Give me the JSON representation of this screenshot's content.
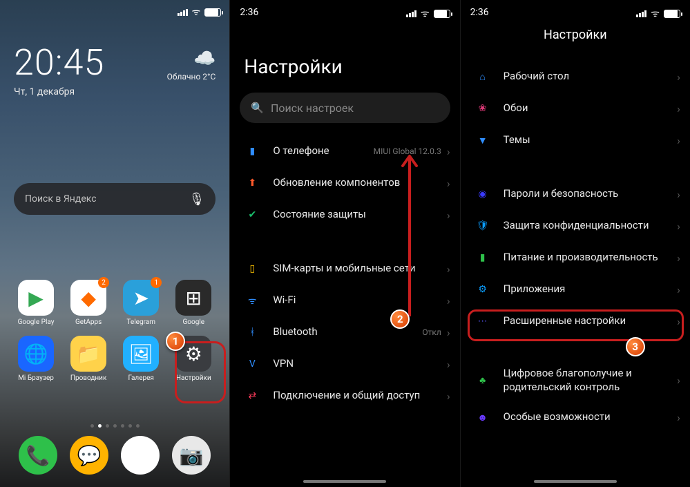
{
  "panel1": {
    "status": {
      "signal": "signal",
      "wifi": "wifi",
      "battery": "85%"
    },
    "clock": {
      "time": "20:45",
      "date": "Чт, 1 декабря"
    },
    "weather": {
      "icon": "☁️",
      "text": "Облачно 2°C"
    },
    "search": {
      "placeholder": "Поиск в Яндекс",
      "mic": "🎤"
    },
    "apps": [
      {
        "name": "google-play",
        "label": "Google Play",
        "bg": "#fff",
        "glyph": "▶",
        "glyphColor": "#34a853"
      },
      {
        "name": "getapps",
        "label": "GetApps",
        "bg": "#fff",
        "glyph": "◆",
        "glyphColor": "#ff6a00",
        "badge": "2"
      },
      {
        "name": "telegram",
        "label": "Telegram",
        "bg": "#2aa0da",
        "glyph": "➤",
        "glyphColor": "#fff",
        "badge": "1"
      },
      {
        "name": "google-folder",
        "label": "Google",
        "bg": "#2a2a2a",
        "glyph": "⊞",
        "glyphColor": "#fff"
      },
      {
        "name": "mi-browser",
        "label": "Mi Браузер",
        "bg": "#1a66ff",
        "glyph": "🌐",
        "glyphColor": "#fff"
      },
      {
        "name": "file-manager",
        "label": "Проводник",
        "bg": "#ffd24a",
        "glyph": "📁",
        "glyphColor": "#fff"
      },
      {
        "name": "gallery",
        "label": "Галерея",
        "bg": "#21b0ff",
        "glyph": "🖼",
        "glyphColor": "#fff"
      },
      {
        "name": "settings-app",
        "label": "Настройки",
        "bg": "#3a3c40",
        "glyph": "⚙",
        "glyphColor": "#fff"
      }
    ],
    "dock": [
      {
        "name": "phone",
        "bg": "#2ec04a",
        "glyph": "📞"
      },
      {
        "name": "messages",
        "bg": "#ffb300",
        "glyph": "💬"
      },
      {
        "name": "chrome",
        "bg": "#fff",
        "glyph": "◉"
      },
      {
        "name": "camera",
        "bg": "#e8e8e8",
        "glyph": "📷"
      }
    ]
  },
  "panel2": {
    "time": "2:36",
    "title": "Настройки",
    "search_placeholder": "Поиск настроек",
    "sections": [
      [
        {
          "icon": "about-icon",
          "color": "#2f8eff",
          "glyph": "▮",
          "label": "О телефоне",
          "value": "MIUI Global 12.0.3"
        },
        {
          "icon": "update-icon",
          "color": "#ff5a2b",
          "glyph": "⬆",
          "label": "Обновление компонентов"
        },
        {
          "icon": "security-icon",
          "color": "#1abc6b",
          "glyph": "✔",
          "label": "Состояние защиты"
        }
      ],
      [
        {
          "icon": "sim-icon",
          "color": "#ffc400",
          "glyph": "▯",
          "label": "SIM-карты и мобильные сети"
        },
        {
          "icon": "wifi-icon",
          "color": "#2f8eff",
          "glyph": "ᯤ",
          "label": "Wi-Fi"
        },
        {
          "icon": "bluetooth-icon",
          "color": "#2f8eff",
          "glyph": "ᚼ",
          "label": "Bluetooth",
          "value": "Откл"
        },
        {
          "icon": "vpn-icon",
          "color": "#2f8eff",
          "glyph": "V",
          "label": "VPN"
        },
        {
          "icon": "connection-icon",
          "color": "#ff3b5b",
          "glyph": "⇄",
          "label": "Подключение и общий доступ"
        }
      ]
    ]
  },
  "panel3": {
    "time": "2:36",
    "title": "Настройки",
    "sections": [
      [
        {
          "icon": "home-icon",
          "color": "#2f8eff",
          "glyph": "⌂",
          "label": "Рабочий стол"
        },
        {
          "icon": "wallpaper-icon",
          "color": "#e23b7a",
          "glyph": "❀",
          "label": "Обои"
        },
        {
          "icon": "themes-icon",
          "color": "#2f8eff",
          "glyph": "▼",
          "label": "Темы"
        }
      ],
      [
        {
          "icon": "passwords-icon",
          "color": "#3a3aff",
          "glyph": "◉",
          "label": "Пароли и безопасность"
        },
        {
          "icon": "privacy-icon",
          "color": "#0a9dff",
          "glyph": "🛡",
          "label": "Защита конфиденциальности"
        },
        {
          "icon": "battery-icon",
          "color": "#2ec04a",
          "glyph": "▮",
          "label": "Питание и производительность"
        },
        {
          "icon": "apps-icon",
          "color": "#0a9dff",
          "glyph": "⚙",
          "label": "Приложения",
          "highlighted": true
        },
        {
          "icon": "advanced-icon",
          "color": "#5a5aff",
          "glyph": "⋯",
          "label": "Расширенные настройки"
        }
      ],
      [
        {
          "icon": "wellbeing-icon",
          "color": "#2ec04a",
          "glyph": "♣",
          "label": "Цифровое благополучие и родительский контроль"
        },
        {
          "icon": "accessibility-icon",
          "color": "#6a3aff",
          "glyph": "☻",
          "label": "Особые возможности"
        }
      ]
    ]
  },
  "annotations": {
    "step1": "1",
    "step2": "2",
    "step3": "3"
  }
}
